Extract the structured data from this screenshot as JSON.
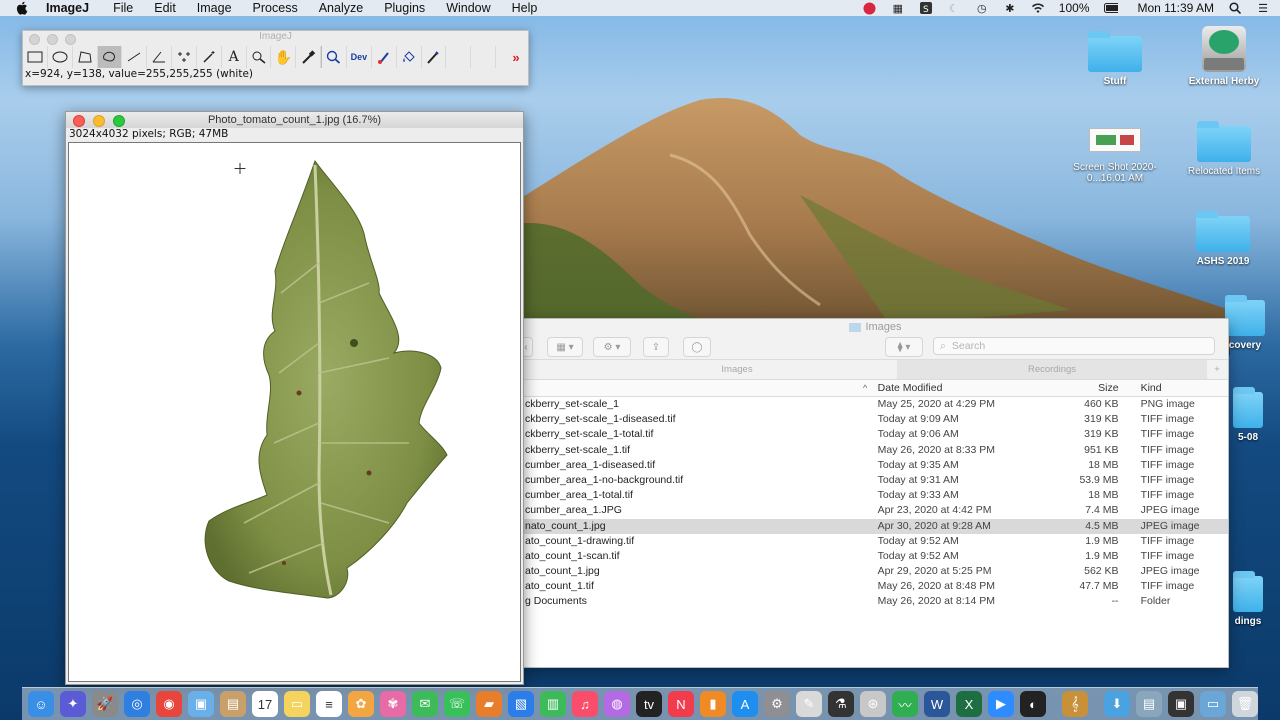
{
  "menubar": {
    "app_name": "ImageJ",
    "items": [
      "File",
      "Edit",
      "Image",
      "Process",
      "Analyze",
      "Plugins",
      "Window",
      "Help"
    ],
    "battery": "100%",
    "clock": "Mon 11:39 AM"
  },
  "imagej": {
    "window_title": "ImageJ",
    "tools": [
      "rectangle-tool",
      "oval-tool",
      "polygon-tool",
      "freehand-tool",
      "straight-line-tool",
      "angle-tool",
      "multipoint-tool",
      "wand-tool",
      "text-tool",
      "magnifier-tool",
      "scroll-tool",
      "color-picker-tool",
      "zoom-tool",
      "developer-menu",
      "brush-tool",
      "flood-fill-tool",
      "pencil-tool",
      "blank-tool-1",
      "blank-tool-2",
      "more-tools"
    ],
    "dev_label": "Dev",
    "more_symbol": "»",
    "status": "x=924, y=138, value=255,255,255 (white)"
  },
  "image_window": {
    "title": "Photo_tomato_count_1.jpg (16.7%)",
    "info": "3024x4032 pixels; RGB; 47MB"
  },
  "finder": {
    "title": "Images",
    "search_placeholder": "Search",
    "tabs": [
      "Images",
      "Recordings"
    ],
    "columns": {
      "name": "",
      "date": "Date Modified",
      "size": "Size",
      "kind": "Kind"
    },
    "rows": [
      {
        "name": "ckberry_set-scale_1",
        "date": "May 25, 2020 at 4:29 PM",
        "size": "460 KB",
        "kind": "PNG image"
      },
      {
        "name": "ckberry_set-scale_1-diseased.tif",
        "date": "Today at 9:09 AM",
        "size": "319 KB",
        "kind": "TIFF image"
      },
      {
        "name": "ckberry_set-scale_1-total.tif",
        "date": "Today at 9:06 AM",
        "size": "319 KB",
        "kind": "TIFF image"
      },
      {
        "name": "ckberry_set-scale_1.tif",
        "date": "May 26, 2020 at 8:33 PM",
        "size": "951 KB",
        "kind": "TIFF image"
      },
      {
        "name": "cumber_area_1-diseased.tif",
        "date": "Today at 9:35 AM",
        "size": "18 MB",
        "kind": "TIFF image"
      },
      {
        "name": "cumber_area_1-no-background.tif",
        "date": "Today at 9:31 AM",
        "size": "53.9 MB",
        "kind": "TIFF image"
      },
      {
        "name": "cumber_area_1-total.tif",
        "date": "Today at 9:33 AM",
        "size": "18 MB",
        "kind": "TIFF image"
      },
      {
        "name": "cumber_area_1.JPG",
        "date": "Apr 23, 2020 at 4:42 PM",
        "size": "7.4 MB",
        "kind": "JPEG image"
      },
      {
        "name": "nato_count_1.jpg",
        "date": "Apr 30, 2020 at 9:28 AM",
        "size": "4.5 MB",
        "kind": "JPEG image",
        "selected": true
      },
      {
        "name": "ato_count_1-drawing.tif",
        "date": "Today at 9:52 AM",
        "size": "1.9 MB",
        "kind": "TIFF image"
      },
      {
        "name": "ato_count_1-scan.tif",
        "date": "Today at 9:52 AM",
        "size": "1.9 MB",
        "kind": "TIFF image"
      },
      {
        "name": "ato_count_1.jpg",
        "date": "Apr 29, 2020 at 5:25 PM",
        "size": "562 KB",
        "kind": "JPEG image"
      },
      {
        "name": "ato_count_1.tif",
        "date": "May 26, 2020 at 8:48 PM",
        "size": "47.7 MB",
        "kind": "TIFF image"
      },
      {
        "name": "g Documents",
        "date": "May 26, 2020 at 8:14 PM",
        "size": "--",
        "kind": "Folder"
      }
    ]
  },
  "desktop_icons": [
    {
      "label": "Stuff",
      "kind": "folder"
    },
    {
      "label": "External Herby",
      "kind": "drive"
    },
    {
      "label": "Screen Shot 2020-0...16.01 AM",
      "kind": "screenshot"
    },
    {
      "label": "Relocated Items",
      "kind": "folder"
    },
    {
      "label": "ASHS 2019",
      "kind": "folder"
    },
    {
      "label": "covery",
      "kind": "folder"
    },
    {
      "label": "5-08",
      "kind": "folder"
    },
    {
      "label": "dings",
      "kind": "folder"
    }
  ],
  "dock": [
    "finder-icon",
    "launchpad-icon",
    "rocket-icon",
    "safari-icon",
    "chrome-icon",
    "preview-icon",
    "notes-folder-icon",
    "calendar-icon",
    "stickies-icon",
    "reminders-icon",
    "photos-app-icon",
    "photos-icon",
    "messages-icon",
    "facetime-icon",
    "books-icon",
    "keynote-icon",
    "numbers-icon",
    "music-icon",
    "podcasts-icon",
    "tv-icon",
    "news-icon",
    "ibooks-icon",
    "app-store-icon",
    "system-preferences-icon",
    "script-editor-icon",
    "imagej-icon",
    "spiral-icon",
    "activity-monitor-icon",
    "word-icon",
    "excel-icon",
    "zoom-icon",
    "obs-icon",
    "cello-icon",
    "downloads-icon",
    "documents-icon",
    "terminal-icon",
    "finder-window-icon",
    "trash-icon"
  ]
}
